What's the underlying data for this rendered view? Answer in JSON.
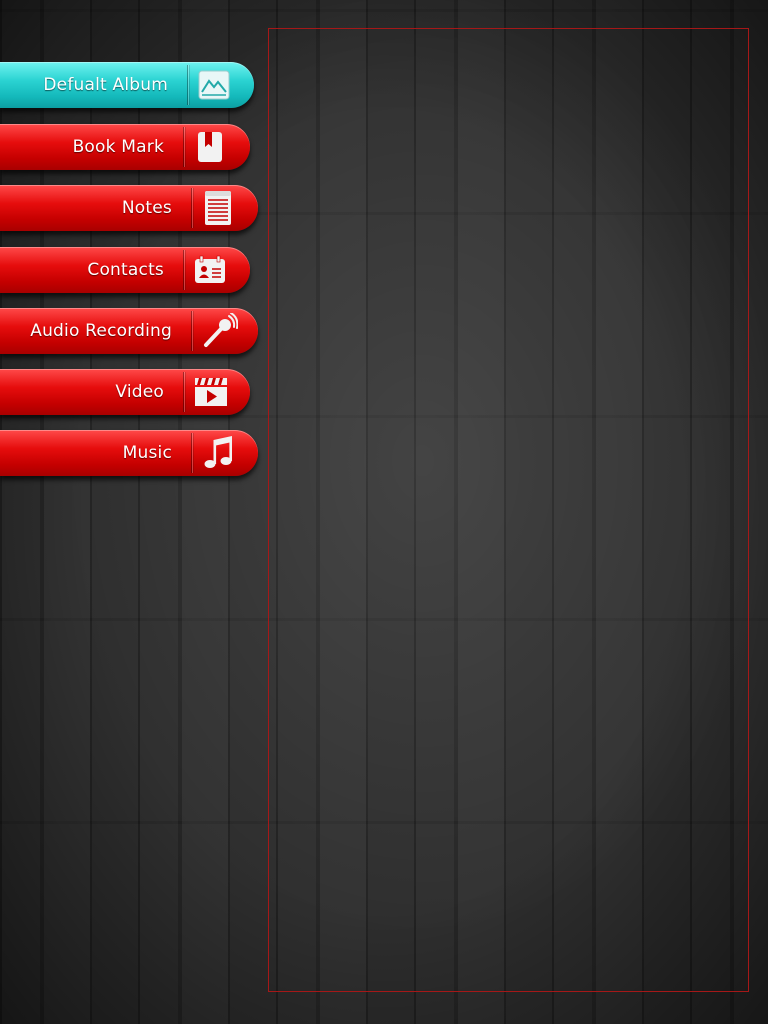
{
  "menu": {
    "items": [
      {
        "label": "Defualt Album",
        "icon": "album-icon",
        "color": "#2bd3d2",
        "selected": true
      },
      {
        "label": "Book Mark",
        "icon": "bookmark-icon",
        "color": "#d90808",
        "selected": false
      },
      {
        "label": "Notes",
        "icon": "notes-icon",
        "color": "#d90808",
        "selected": false
      },
      {
        "label": "Contacts",
        "icon": "contacts-icon",
        "color": "#d90808",
        "selected": false
      },
      {
        "label": "Audio Recording",
        "icon": "microphone-icon",
        "color": "#d90808",
        "selected": false
      },
      {
        "label": "Video",
        "icon": "video-icon",
        "color": "#d90808",
        "selected": false
      },
      {
        "label": "Music",
        "icon": "music-note-icon",
        "color": "#d90808",
        "selected": false
      }
    ]
  },
  "content_panel": {
    "border_color": "#a51818"
  }
}
